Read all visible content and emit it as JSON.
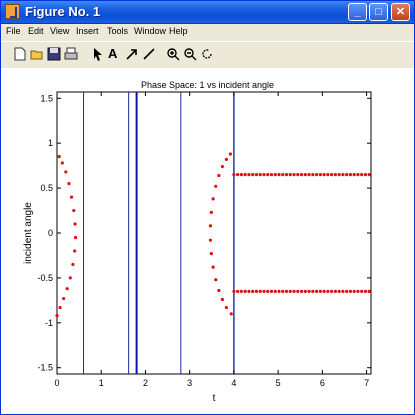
{
  "window": {
    "title": "Figure No. 1",
    "minimize": "_",
    "maximize": "□",
    "close": "✕"
  },
  "menu": [
    "File",
    "Edit",
    "View",
    "Insert",
    "Tools",
    "Window",
    "Help"
  ],
  "toolbar": {
    "icons": [
      "new-file-icon",
      "open-file-icon",
      "save-icon",
      "print-icon",
      "arrow-select-icon",
      "text-tool-icon",
      "arrow-tool-icon",
      "line-tool-icon",
      "zoom-in-icon",
      "zoom-out-icon",
      "rotate-icon"
    ],
    "text_tool_label": "A"
  },
  "chart_data": {
    "type": "scatter",
    "title": "Phase Space:  1 vs incident angle",
    "xlabel": "t",
    "ylabel": "incident angle",
    "xlim": [
      0,
      7.1
    ],
    "ylim": [
      -1.57,
      1.57
    ],
    "xticks": [
      "0",
      "1",
      "2",
      "3",
      "4",
      "5",
      "6",
      "7"
    ],
    "yticks": [
      "-1.5",
      "-1",
      "-0.5",
      "0",
      "0.5",
      "1",
      "1.5"
    ],
    "vertical_lines": [
      0.6,
      1.62,
      1.8,
      2.8,
      4.0
    ],
    "series": [
      {
        "points": [
          [
            0.05,
            0.85
          ],
          [
            0.12,
            0.78
          ],
          [
            0.2,
            0.68
          ],
          [
            0.27,
            0.55
          ],
          [
            0.33,
            0.4
          ],
          [
            0.38,
            0.25
          ],
          [
            0.41,
            0.1
          ],
          [
            0.42,
            -0.05
          ],
          [
            0.4,
            -0.2
          ],
          [
            0.36,
            -0.35
          ],
          [
            0.3,
            -0.5
          ],
          [
            0.23,
            -0.62
          ],
          [
            0.15,
            -0.73
          ],
          [
            0.07,
            -0.83
          ],
          [
            0.0,
            -0.92
          ]
        ]
      },
      {
        "points": [
          [
            3.92,
            0.88
          ],
          [
            3.83,
            0.82
          ],
          [
            3.74,
            0.74
          ],
          [
            3.66,
            0.64
          ],
          [
            3.59,
            0.52
          ],
          [
            3.53,
            0.38
          ],
          [
            3.49,
            0.23
          ],
          [
            3.47,
            0.08
          ],
          [
            3.47,
            -0.08
          ],
          [
            3.49,
            -0.23
          ],
          [
            3.53,
            -0.38
          ],
          [
            3.59,
            -0.52
          ],
          [
            3.66,
            -0.64
          ],
          [
            3.74,
            -0.74
          ],
          [
            3.83,
            -0.83
          ],
          [
            3.94,
            -0.9
          ]
        ]
      }
    ],
    "upper_line": {
      "y": 0.65,
      "x_start": 4.0,
      "x_end": 7.1
    },
    "lower_line": {
      "y": -0.65,
      "x_start": 4.0,
      "x_end": 7.1
    },
    "colors": {
      "points": "#dd1111",
      "lines": "#1a2a9a",
      "bold_line": "#0a14b0"
    }
  }
}
